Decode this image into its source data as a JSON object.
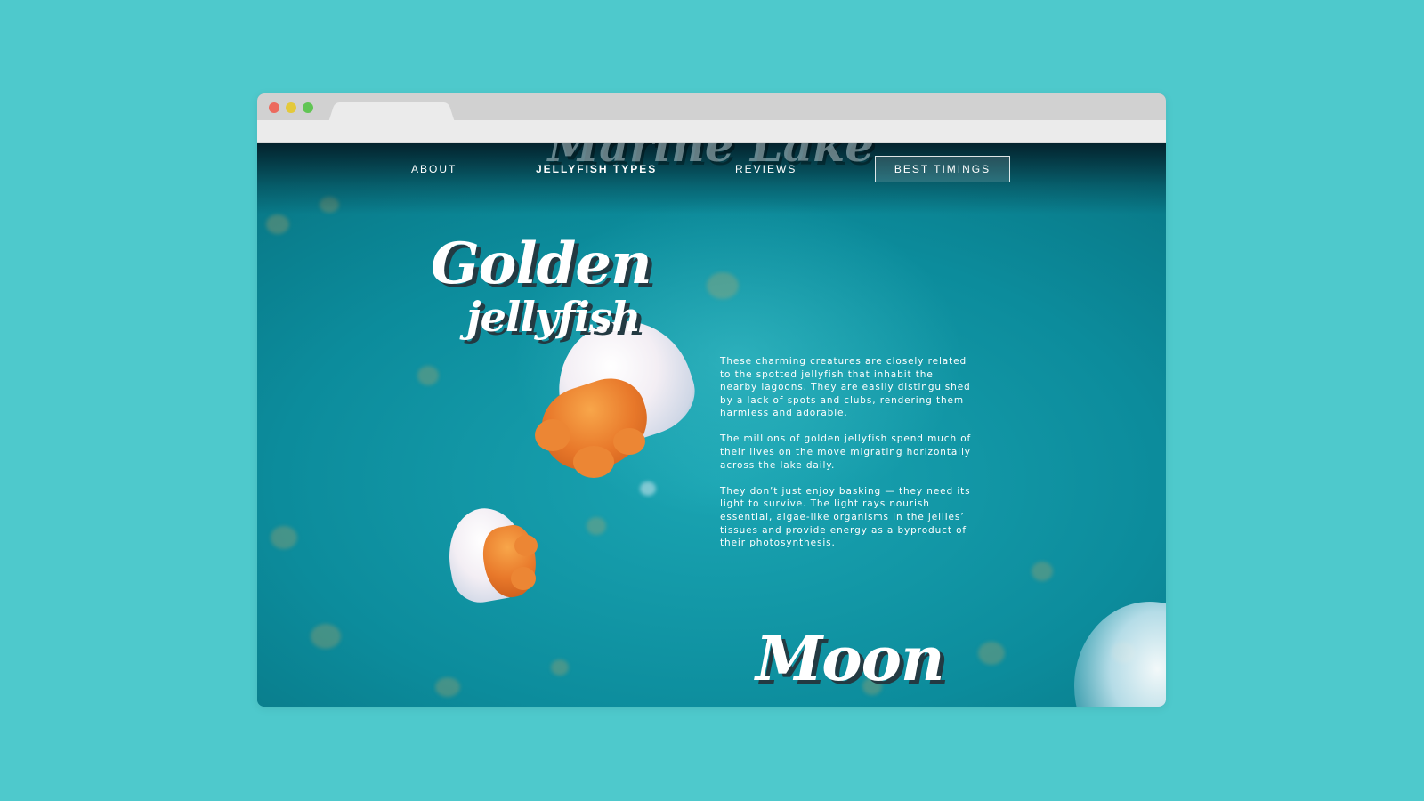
{
  "nav": {
    "links": [
      "ABOUT",
      "JELLYFISH TYPES",
      "REVIEWS"
    ],
    "cta": "BEST TIMINGS"
  },
  "hero": {
    "title_line1": "Golden",
    "title_line2": "jellyfish",
    "paragraphs": [
      "These charming creatures are closely related to the spotted jellyfish that inhabit the nearby lagoons. They are easily distinguished by a lack of spots and clubs, rendering them harmless and adorable.",
      "The millions of golden jellyfish spend much of their lives on the move migrating horizontally across the lake daily.",
      "They don’t just enjoy basking — they need its light to survive. The light rays nourish essential, algae-like organisms in the jellies’ tissues and provide energy as a byproduct of their photosynthesis."
    ]
  },
  "next_section": {
    "title": "Moon"
  },
  "colors": {
    "page_background": "#4ec9cc",
    "water": "#0c8c9c",
    "chrome_top": "#d1d1d1",
    "chrome_bar": "#ebebeb",
    "close_dot": "#ec6a5e",
    "minimize_dot": "#e4c93a",
    "maximize_dot": "#61c554"
  }
}
